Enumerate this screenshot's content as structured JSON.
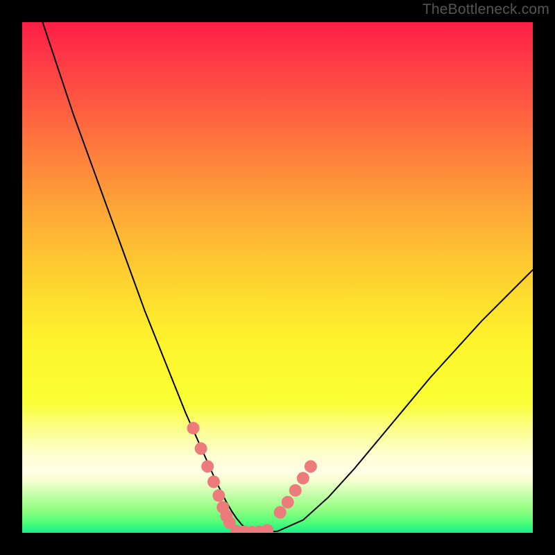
{
  "attribution": "TheBottleneck.com",
  "colors": {
    "background": "#000000",
    "curve_stroke": "#000000",
    "marker_fill": "#ed7b7b",
    "attribution_text": "#555555"
  },
  "chart_data": {
    "type": "line",
    "title": "",
    "xlabel": "",
    "ylabel": "",
    "xlim": [
      0,
      100
    ],
    "ylim": [
      0,
      100
    ],
    "grid": false,
    "legend": false,
    "series": [
      {
        "name": "bottleneck-curve",
        "x": [
          4,
          6,
          8,
          10,
          12,
          14,
          16,
          18,
          20,
          22,
          24,
          26,
          28,
          30,
          32,
          34,
          36,
          38,
          39,
          40,
          41,
          42,
          43,
          44,
          45,
          47,
          50,
          55,
          60,
          65,
          70,
          75,
          80,
          85,
          90,
          95,
          100
        ],
        "y": [
          100,
          94,
          88,
          82,
          76.5,
          71,
          65.5,
          60,
          54.5,
          49,
          43.5,
          38.5,
          33.5,
          28.5,
          23.5,
          19,
          14.5,
          10,
          8,
          6,
          4.3,
          2.8,
          1.6,
          0.8,
          0.3,
          0.1,
          0.3,
          2.5,
          7,
          12.5,
          18.5,
          24.5,
          30.5,
          36,
          41.5,
          46.5,
          51.5
        ]
      }
    ],
    "markers": [
      {
        "name": "left-cluster",
        "x": [
          33.5,
          35,
          36.3,
          37.5,
          38.5,
          39.3,
          40.0,
          40.6
        ],
        "y": [
          20.5,
          16.5,
          13.0,
          10.0,
          7.3,
          5.0,
          3.3,
          2.0
        ]
      },
      {
        "name": "right-cluster",
        "x": [
          50.5,
          52,
          53.5,
          55,
          56.5
        ],
        "y": [
          4.0,
          6.0,
          8.3,
          10.7,
          13.0
        ]
      },
      {
        "name": "bottom-cluster",
        "x": [
          42.0,
          43.5,
          45.0,
          46.5,
          48.0
        ],
        "y": [
          0.3,
          0.2,
          0.15,
          0.2,
          0.5
        ]
      }
    ]
  }
}
